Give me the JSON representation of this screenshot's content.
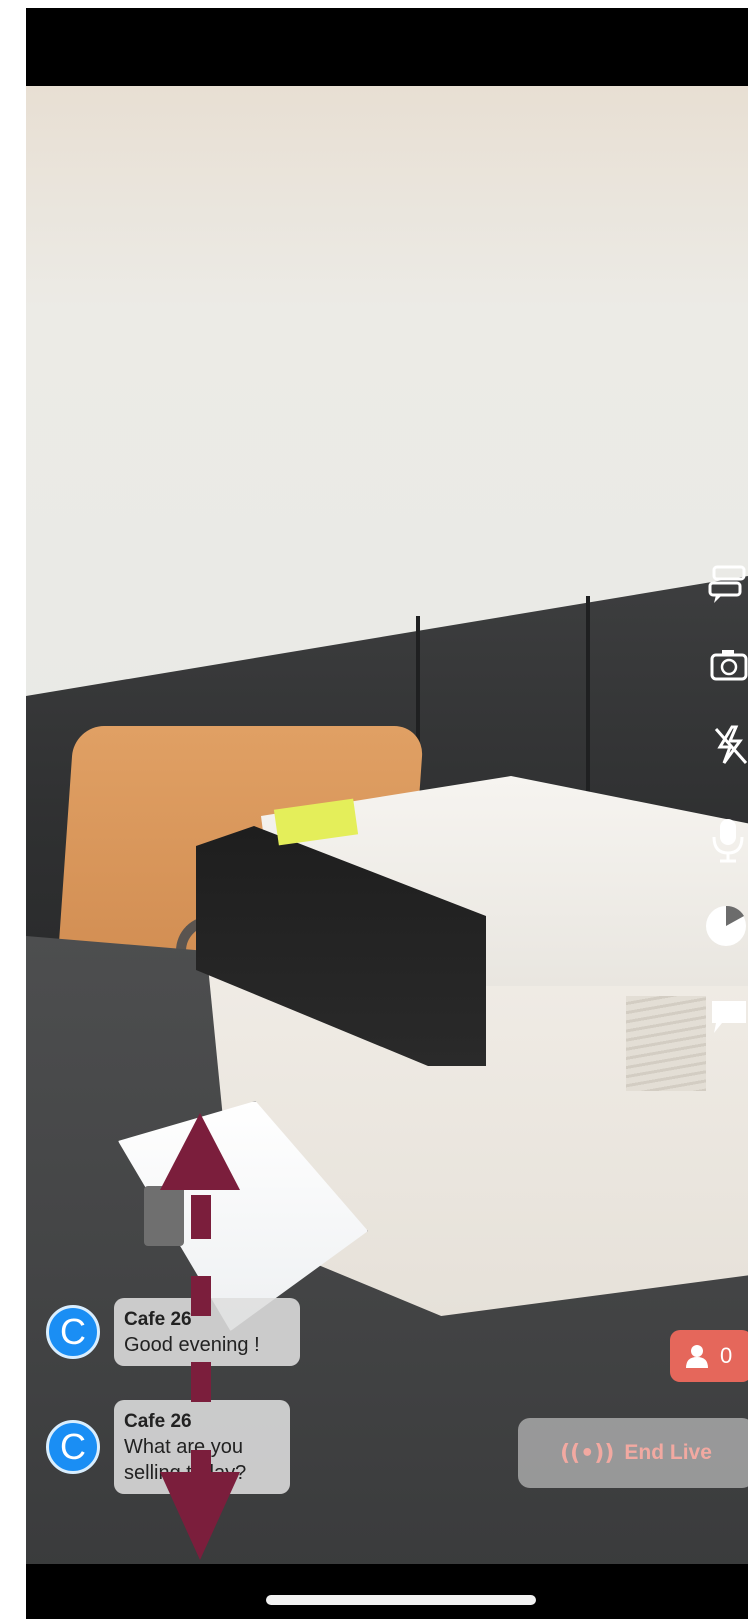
{
  "stream": {
    "viewer_count": "0",
    "end_live_label": "End Live",
    "end_live_icon": "((•))"
  },
  "chat": {
    "messages": [
      {
        "avatar_letter": "C",
        "name": "Cafe 26",
        "text": "Good evening !"
      },
      {
        "avatar_letter": "C",
        "name": "Cafe 26",
        "text": "What are you selling today?"
      }
    ]
  },
  "controls": [
    {
      "icon": "chat-bubbles-icon"
    },
    {
      "icon": "camera-switch-icon"
    },
    {
      "icon": "flash-off-icon"
    },
    {
      "icon": "microphone-icon"
    },
    {
      "icon": "beauty-filter-icon"
    },
    {
      "icon": "comment-icon"
    }
  ],
  "colors": {
    "viewer_badge": "#e5675b",
    "avatar": "#1a8ef4",
    "arrow": "#7b1e3c",
    "end_live_text": "#f2a9a1"
  }
}
